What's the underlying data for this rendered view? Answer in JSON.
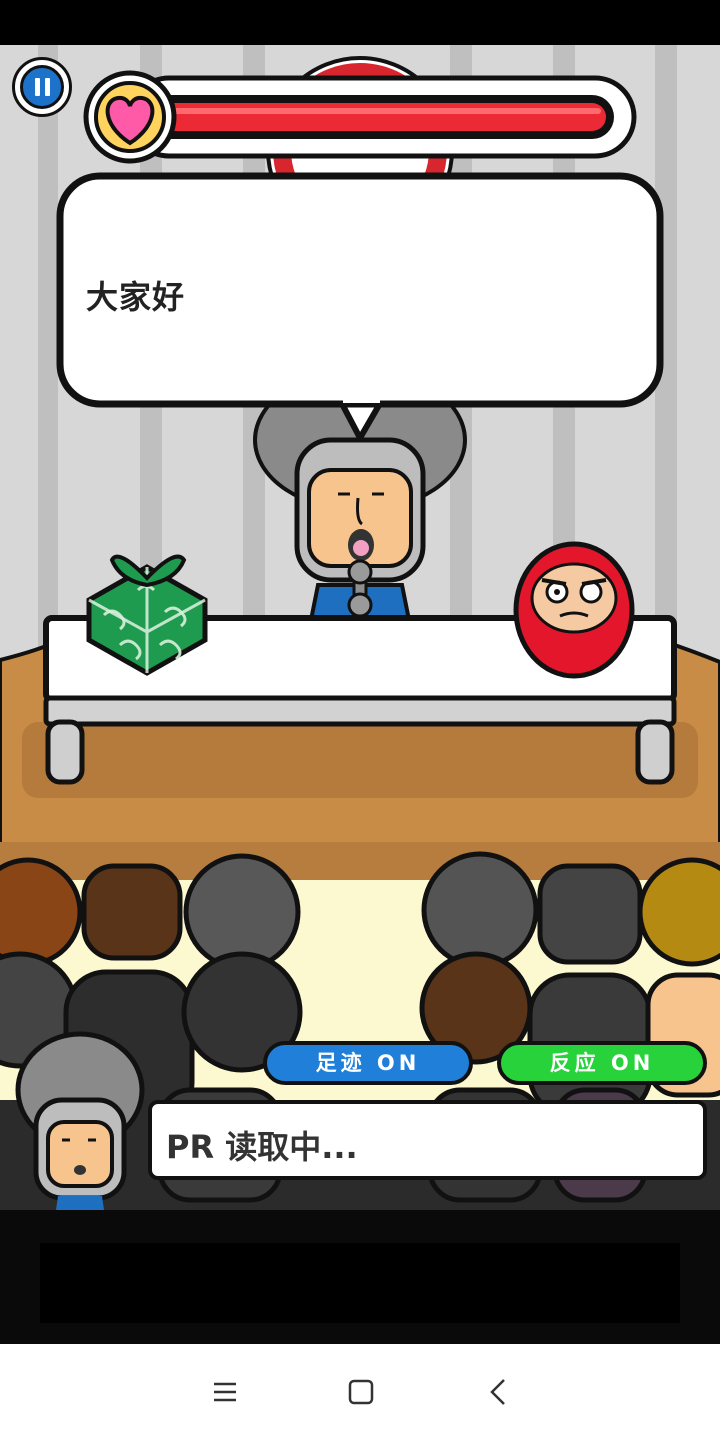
{
  "speech_bubble": {
    "text": "大家好"
  },
  "toggles": {
    "footprint_label": "足迹 ON",
    "reaction_label": "反应 ON"
  },
  "status_box": {
    "text": "PR 读取中..."
  },
  "health": {
    "fraction": 1.0,
    "color": "#ec2a35"
  },
  "colors": {
    "pause_button": "#1c73c9",
    "footprint_button": "#1f7fd9",
    "reaction_button": "#27d23a",
    "heart": "#ff5aa8",
    "daruma": "#e3162b",
    "gift_wrap": "#1e9b4e",
    "stage": "#c98c47"
  },
  "icons": {
    "pause": "pause-icon",
    "heart": "heart-icon",
    "nav_menu": "menu-icon",
    "nav_home": "home-icon",
    "nav_back": "back-icon"
  }
}
